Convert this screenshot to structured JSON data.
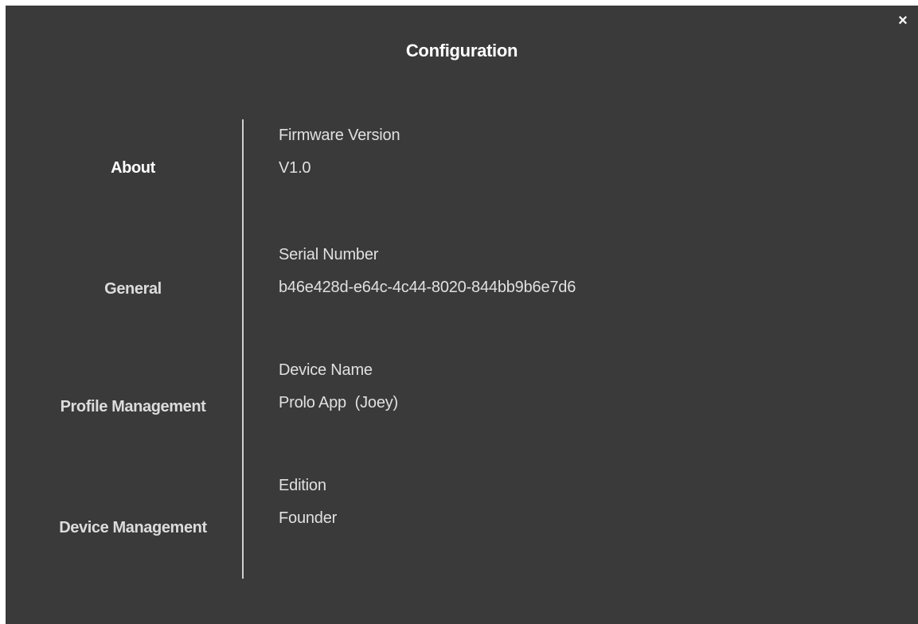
{
  "dialog": {
    "title": "Configuration",
    "close_label": "×"
  },
  "sidebar": {
    "items": [
      {
        "label": "About",
        "active": true
      },
      {
        "label": "General",
        "active": false
      },
      {
        "label": "Profile Management",
        "active": false
      },
      {
        "label": "Device Management",
        "active": false
      }
    ]
  },
  "about": {
    "fields": [
      {
        "label": "Firmware Version",
        "value": "V1.0"
      },
      {
        "label": "Serial Number",
        "value": "b46e428d-e64c-4c44-8020-844bb9b6e7d6"
      },
      {
        "label": "Device Name",
        "value": "Prolo App  (Joey)"
      },
      {
        "label": "Edition",
        "value": "Founder"
      }
    ]
  },
  "colors": {
    "background": "#3a3a3a",
    "text": "#ffffff",
    "divider": "#cfcfcf"
  }
}
